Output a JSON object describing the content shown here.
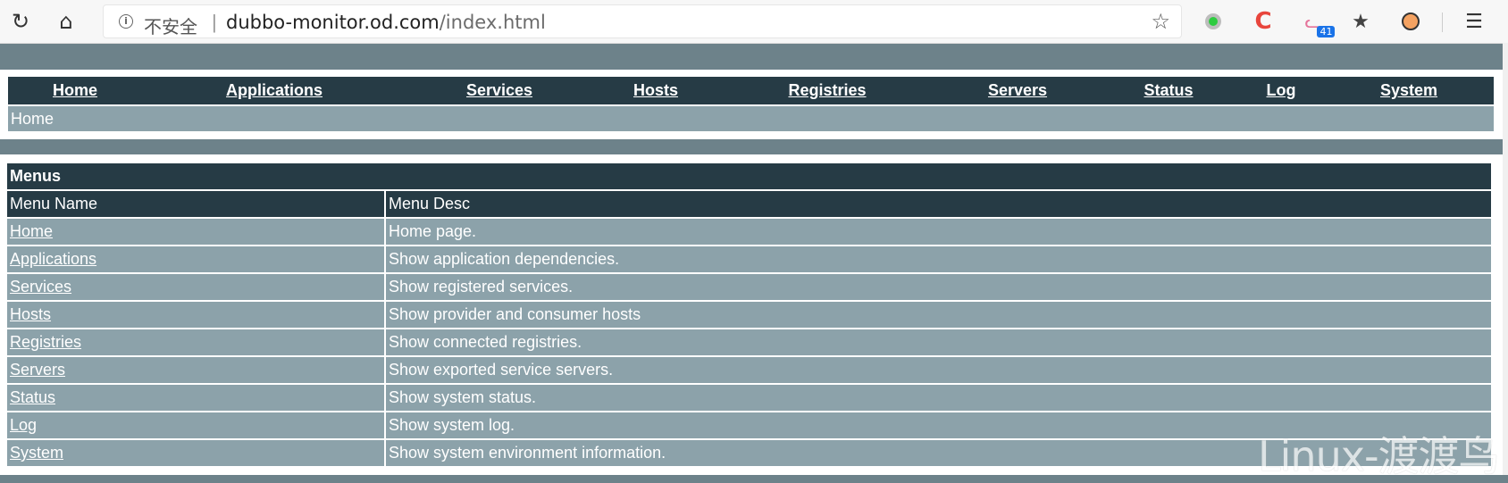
{
  "browser": {
    "security_label": "不安全",
    "separator": "|",
    "url_host": "dubbo-monitor.od.com",
    "url_path": "/index.html",
    "extension_badge": "41"
  },
  "nav": {
    "items": [
      "Home",
      "Applications",
      "Services",
      "Hosts",
      "Registries",
      "Servers",
      "Status",
      "Log",
      "System"
    ]
  },
  "breadcrumb": "Home",
  "menus": {
    "title": "Menus",
    "headers": [
      "Menu Name",
      "Menu Desc"
    ],
    "rows": [
      {
        "name": "Home",
        "desc": "Home page."
      },
      {
        "name": "Applications",
        "desc": "Show application dependencies."
      },
      {
        "name": "Services",
        "desc": "Show registered services."
      },
      {
        "name": "Hosts",
        "desc": "Show provider and consumer hosts"
      },
      {
        "name": "Registries",
        "desc": "Show connected registries."
      },
      {
        "name": "Servers",
        "desc": "Show exported service servers."
      },
      {
        "name": "Status",
        "desc": "Show system status."
      },
      {
        "name": "Log",
        "desc": "Show system log."
      },
      {
        "name": "System",
        "desc": "Show system environment information."
      }
    ]
  },
  "watermark": "Linux-渡渡鸟",
  "colors": {
    "page_bg": "#6d828a",
    "header_bg": "#263b45",
    "row_bg": "#8ca2aa"
  },
  "icons": [
    "reload-icon",
    "home-icon",
    "info-icon",
    "favorite-star-icon",
    "extension-green-icon",
    "extension-c-icon",
    "extension-cat-icon",
    "bookmark-star-icon",
    "extension-face-icon",
    "favorites-menu-icon"
  ]
}
